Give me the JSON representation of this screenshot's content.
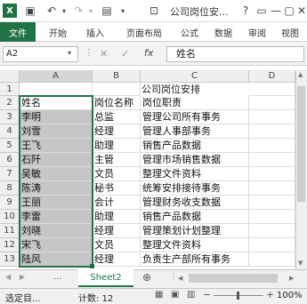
{
  "app": {
    "icon_label": "X",
    "window_title": "公司岗位安...",
    "window_controls": [
      "?",
      "▭",
      "—",
      "▢",
      "✕"
    ]
  },
  "ribbon": {
    "tabs": [
      "文件",
      "开始",
      "插入",
      "页面布局",
      "公式",
      "数据",
      "审阅",
      "视图"
    ]
  },
  "formula_bar": {
    "name_box": "A2",
    "cancel": "✕",
    "enter": "✓",
    "fx": "fx",
    "content": "姓名"
  },
  "sheet": {
    "columns": [
      "A",
      "B",
      "C",
      "D"
    ],
    "rows": [
      "1",
      "2",
      "3",
      "4",
      "5",
      "6",
      "7",
      "8",
      "9",
      "10",
      "11",
      "12",
      "13"
    ],
    "title": "公司岗位安排",
    "data": [
      [
        "姓名",
        "岗位名称",
        "岗位职责"
      ],
      [
        "李明",
        "总监",
        "管理公司所有事务"
      ],
      [
        "刘雪",
        "经理",
        "管理人事部事务"
      ],
      [
        "王飞",
        "助理",
        "销售产品数据"
      ],
      [
        "石阡",
        "主管",
        "管理市场销售数据"
      ],
      [
        "吴敏",
        "文员",
        "整理文件资料"
      ],
      [
        "陈涛",
        "秘书",
        "统筹安排接待事务"
      ],
      [
        "王丽",
        "会计",
        "管理财务收支数据"
      ],
      [
        "李雷",
        "助理",
        "销售产品数据"
      ],
      [
        "刘晓",
        "经理",
        "管理策划计划整理"
      ],
      [
        "宋飞",
        "文员",
        "整理文件资料"
      ],
      [
        "陆风",
        "经理",
        "负责生产部所有事务"
      ]
    ]
  },
  "sheet_tabs": {
    "nav_prev": "◀",
    "nav_next": "▶",
    "ellipsis": "...",
    "active": "Sheet2",
    "add": "⊕"
  },
  "status": {
    "mode": "选定目...",
    "count_label": "计数: 12",
    "zoom": "100%"
  }
}
